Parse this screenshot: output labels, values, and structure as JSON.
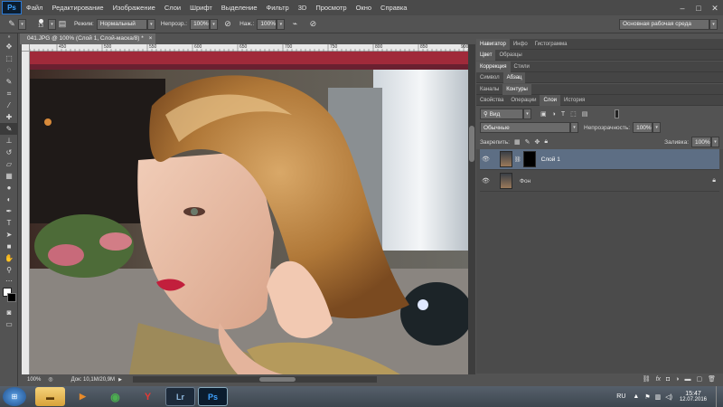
{
  "menu": [
    "Файл",
    "Редактирование",
    "Изображение",
    "Слои",
    "Шрифт",
    "Выделение",
    "Фильтр",
    "3D",
    "Просмотр",
    "Окно",
    "Справка"
  ],
  "app_logo": "Ps",
  "options": {
    "brush_size": "13",
    "mode_label": "Режим:",
    "mode_value": "Нормальный",
    "opacity_label": "Непрозр.:",
    "opacity_value": "100%",
    "pressure_label": "Наж.:",
    "pressure_value": "100%",
    "workspace": "Основная рабочая среда"
  },
  "document": {
    "tab_title": "041.JPG @ 100% (Слой 1, Слой-маска/8) *",
    "ruler_ticks": [
      "450",
      "500",
      "550",
      "600",
      "650",
      "700",
      "750",
      "800",
      "850",
      "900"
    ],
    "zoom": "100%",
    "doc_size": "Док: 10,1M/20,9M"
  },
  "panels": {
    "row1_tabs": [
      "Навигатор",
      "Инфо",
      "Гистограмма"
    ],
    "row2_tabs": [
      "Цвет",
      "Образцы"
    ],
    "row3_tabs": [
      "Коррекция",
      "Стили"
    ],
    "row4_tabs": [
      "Символ",
      "Абзац"
    ],
    "row5_tabs": [
      "Каналы",
      "Контуры"
    ],
    "row6_tabs": [
      "Свойства",
      "Операции",
      "Слои",
      "История"
    ],
    "filter_kind": "Вид",
    "blend_mode": "Обычные",
    "opacity_label": "Непрозрачность:",
    "opacity_value": "100%",
    "lock_label": "Закрепить:",
    "fill_label": "Заливка:",
    "fill_value": "100%",
    "layers": [
      {
        "name": "Слой 1",
        "selected": true
      },
      {
        "name": "Фон",
        "selected": false
      }
    ]
  },
  "taskbar": {
    "lang": "RU",
    "time": "15:47",
    "date": "12.07.2016"
  }
}
